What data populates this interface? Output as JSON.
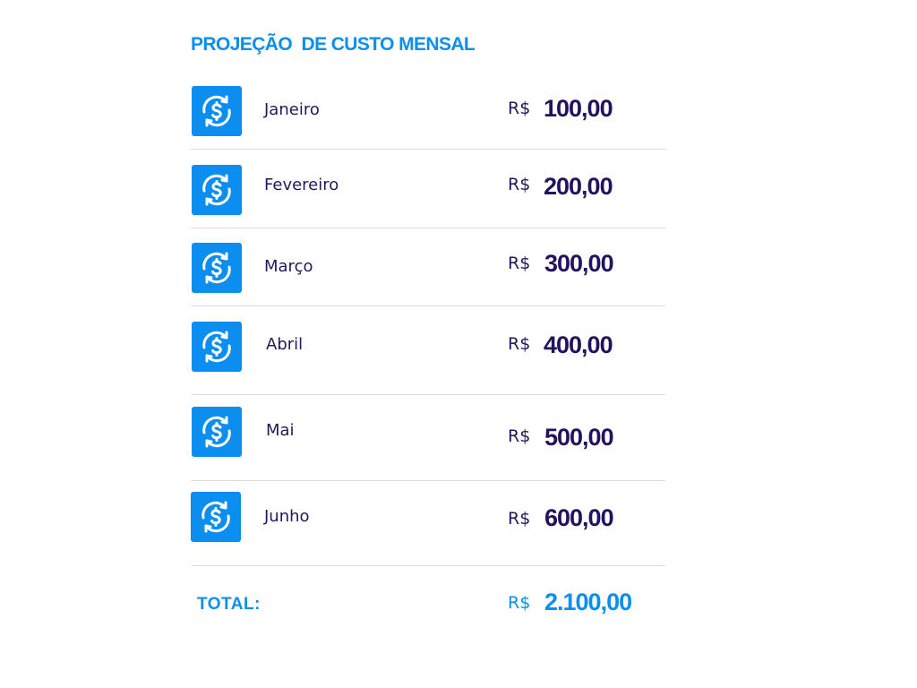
{
  "title": "PROJEÇÃO  DE CUSTO MENSAL",
  "currency_symbol": "R$",
  "rows": [
    {
      "month": "Janeiro",
      "amount": "100,00"
    },
    {
      "month": "Fevereiro",
      "amount": "200,00"
    },
    {
      "month": "Março",
      "amount": "300,00"
    },
    {
      "month": "Abril",
      "amount": "400,00"
    },
    {
      "month": "Mai",
      "amount": "500,00"
    },
    {
      "month": "Junho",
      "amount": "600,00"
    }
  ],
  "total": {
    "label": "TOTAL:",
    "currency_symbol": "R$",
    "amount": "2.100,00"
  },
  "colors": {
    "accent": "#0b8ef0",
    "text_dark": "#1f1a5a",
    "amount_dark": "#22135e",
    "divider": "#dcdcdc"
  },
  "icon": "dollar-exchange-icon"
}
